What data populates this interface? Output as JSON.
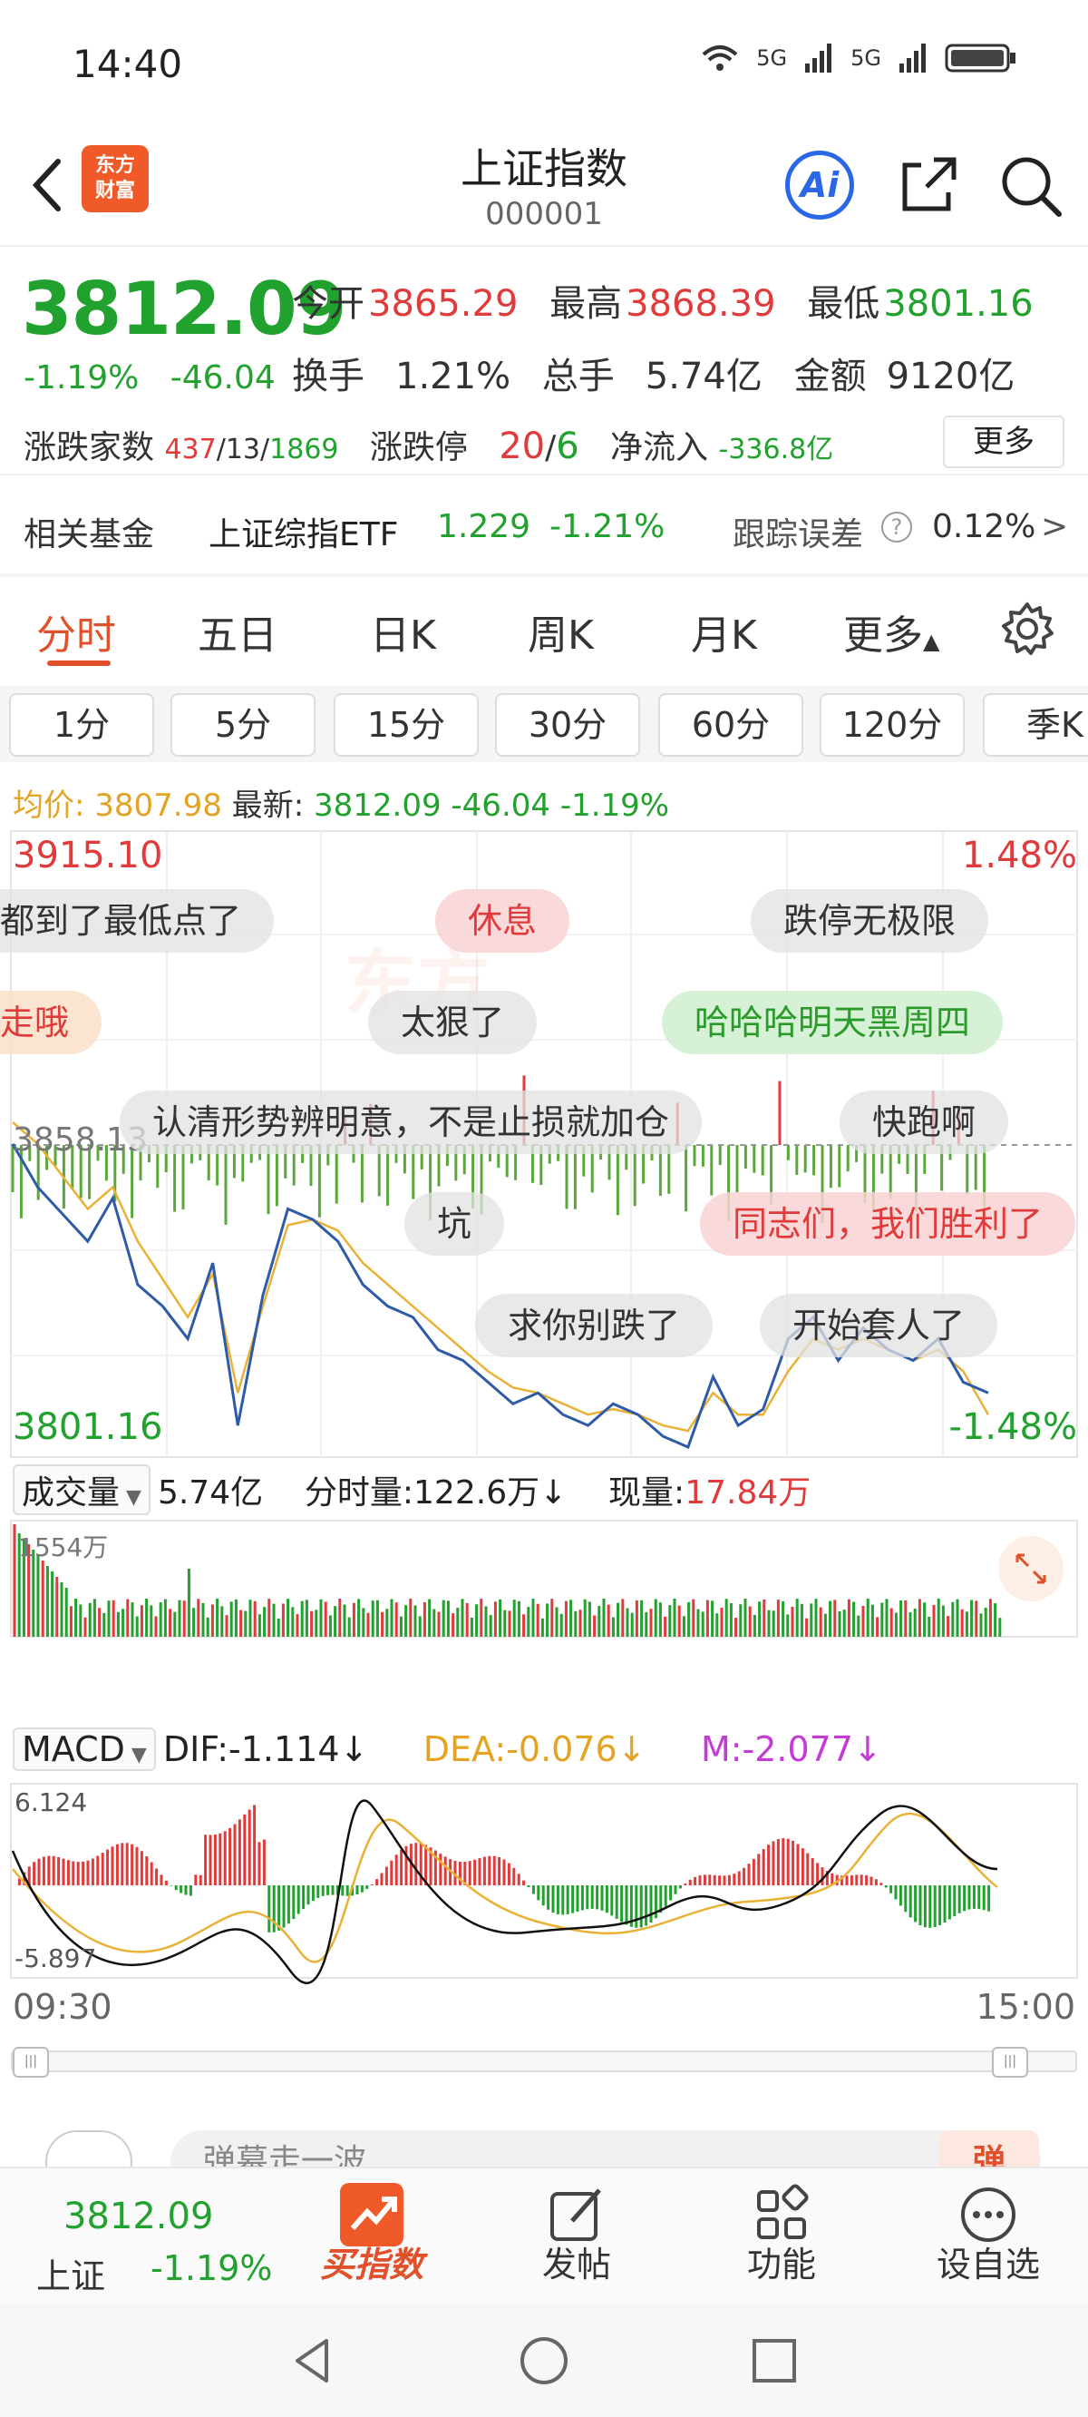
{
  "status": {
    "time": "14:40",
    "signal1": "5G",
    "signal2": "5G"
  },
  "header": {
    "logo_text_1": "东方",
    "logo_text_2": "财富",
    "title": "上证指数",
    "code": "000001",
    "ai_label": "Ai"
  },
  "quote": {
    "price": "3812.09",
    "change_pct": "-1.19%",
    "change_abs": "-46.04",
    "open_label": "今开",
    "open": "3865.29",
    "high_label": "最高",
    "high": "3868.39",
    "low_label": "最低",
    "low": "3801.16",
    "turnover_label": "换手",
    "turnover": "1.21%",
    "volume_label": "总手",
    "volume": "5.74亿",
    "amount_label": "金额",
    "amount": "9120亿",
    "breadth_label": "涨跌家数",
    "up": "437",
    "flat": "13",
    "down": "1869",
    "limit_label": "涨跌停",
    "limit_up": "20",
    "limit_down": "6",
    "inflow_label": "净流入",
    "inflow": "-336.8亿",
    "more": "更多"
  },
  "fund": {
    "label": "相关基金",
    "name": "上证综指ETF",
    "price": "1.229",
    "change": "-1.21%",
    "tracking_label": "跟踪误差",
    "tracking": "0.12%",
    "arrow": ">"
  },
  "tabs": [
    "分时",
    "五日",
    "日K",
    "周K",
    "月K",
    "更多"
  ],
  "intervals": [
    "1分",
    "5分",
    "15分",
    "30分",
    "60分",
    "120分",
    "季K"
  ],
  "avg": {
    "avg_label": "均价:",
    "avg": "3807.98",
    "latest_label": "最新:",
    "latest": "3812.09",
    "chg": "-46.04",
    "pct": "-1.19%"
  },
  "chart": {
    "top_price": "3915.10",
    "top_pct": "1.48%",
    "bottom_price": "3801.16",
    "bottom_pct": "-1.48%",
    "mid_price": "3858.13",
    "bubbles": [
      "都到了最低点了",
      "休息",
      "跌停无极限",
      "走哦",
      "太狠了",
      "哈哈哈明天黑周四",
      "认清形势辨明意，不是止损就加仓",
      "快跑啊",
      "坑",
      "同志们，我们胜利了",
      "求你别跌了",
      "开始套人了"
    ],
    "volume_max": "1554万",
    "macd_max": "6.124",
    "macd_min": "-5.897",
    "time_start": "09:30",
    "time_end": "15:00"
  },
  "volume_bar": {
    "label": "成交量",
    "total": "5.74亿",
    "minute_label": "分时量:",
    "minute": "122.6万",
    "minute_arrow": "↓",
    "current_label": "现量:",
    "current": "17.84万"
  },
  "macd": {
    "label": "MACD",
    "dif_label": "DIF:",
    "dif": "-1.114",
    "dif_arrow": "↓",
    "dea_label": "DEA:",
    "dea": "-0.076",
    "dea_arrow": "↓",
    "m_label": "M:",
    "m": "-2.077",
    "m_arrow": "↓"
  },
  "comment": {
    "placeholder": "弹幕走一波",
    "send": "弹"
  },
  "bottom_nav": {
    "price": "3812.09",
    "name": "上证",
    "pct": "-1.19%",
    "buy": "买指数",
    "post": "发帖",
    "features": "功能",
    "watch": "设自选"
  },
  "chart_data": {
    "type": "line",
    "title": "",
    "x_range": [
      "09:30",
      "15:00"
    ],
    "ylim": [
      3801.16,
      3915.1
    ],
    "series": [
      {
        "values": [
          3858,
          3850,
          3845,
          3840,
          3848,
          3832,
          3828,
          3822,
          3836,
          3806,
          3830,
          3846,
          3844,
          3840,
          3832,
          3828,
          3826,
          3820,
          3818,
          3814,
          3810,
          3812,
          3808,
          3806,
          3810,
          3808,
          3804,
          3802,
          3815,
          3806,
          3809,
          3822,
          3826,
          3818,
          3824,
          3820,
          3818,
          3822,
          3814,
          3812
        ]
      },
      {
        "values": [
          3862,
          3858,
          3852,
          3846,
          3850,
          3840,
          3833,
          3826,
          3834,
          3812,
          3828,
          3843,
          3844,
          3842,
          3836,
          3832,
          3828,
          3824,
          3820,
          3816,
          3813,
          3812,
          3810,
          3808,
          3809,
          3808,
          3806,
          3805,
          3812,
          3808,
          3808,
          3816,
          3822,
          3820,
          3822,
          3820,
          3818,
          3820,
          3816,
          3808
        ]
      }
    ]
  }
}
